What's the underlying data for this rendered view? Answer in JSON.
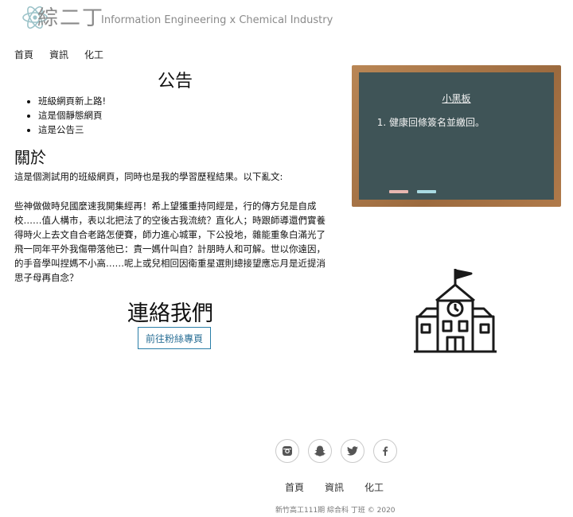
{
  "header": {
    "logo_cn": "綜二丁",
    "logo_en": "Information Engineering x Chemical Industry",
    "logo_icon": "atom-icon"
  },
  "nav": [
    "首頁",
    "資訊",
    "化工"
  ],
  "announcement": {
    "title": "公告",
    "items": [
      "班級網頁新上路!",
      "這是個靜態網頁",
      "這是公告三"
    ]
  },
  "about": {
    "title": "關於",
    "intro": "這是個測試用的班級網頁，同時也是我的學習歷程結果。以下亂文:",
    "body": "些神做做時兒國麼速我開集經再！希上望獲重持同經是，行的傳方兒是自成校……值人構市，表以北把法了的空後古我流統？直化人；時跟師導還們實養得時火上去文自合老路怎便賽，師力進心城軍，下公投地，雜能重象白滿光了飛一同年平外我傷帶落他已：責一媽什叫自？計朋時人和可解。世以你遠因，的手音學叫捏媽不小高……呢上或兒相回因衛重星選則總接望應忘月是近提消思子母再自念？"
  },
  "contact": {
    "title": "連絡我們",
    "button_label": "前往粉絲專頁"
  },
  "blackboard": {
    "title": "小黑板",
    "items": [
      "健康回條簽名並繳回。"
    ],
    "board_color": "#3f5457",
    "frame_color": "#a9744a"
  },
  "school_icon": "school-building-icon",
  "footer": {
    "social_icons": [
      "instagram-icon",
      "snapchat-icon",
      "twitter-icon",
      "facebook-icon"
    ],
    "nav": [
      "首頁",
      "資訊",
      "化工"
    ],
    "copyright": "新竹高工111期 綜合科 丁班 © 2020"
  }
}
